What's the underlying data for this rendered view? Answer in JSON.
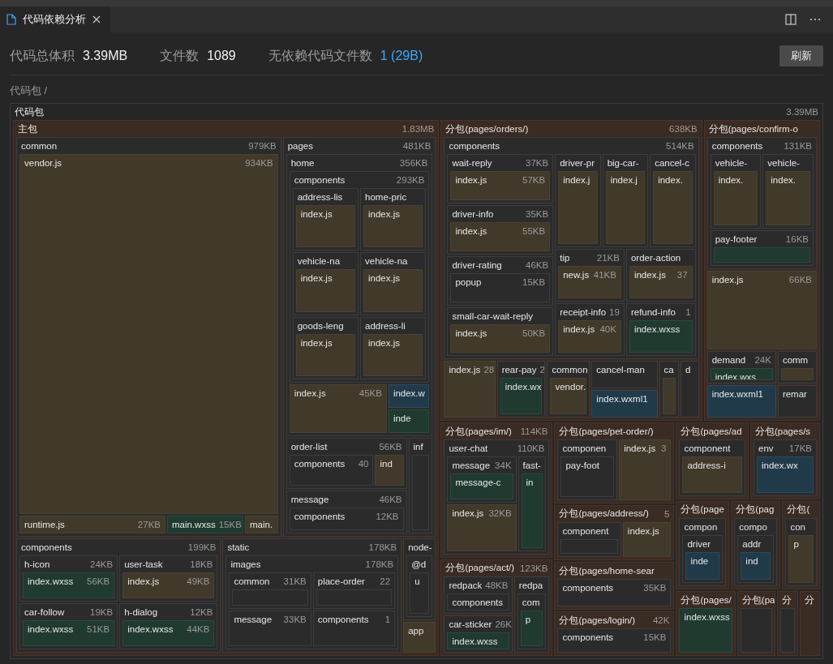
{
  "tab": {
    "title": "代码依赖分析",
    "selected": true
  },
  "stats": [
    {
      "label": "代码总体积",
      "value": "3.39MB",
      "kind": "plain"
    },
    {
      "label": "文件数",
      "value": "1089",
      "kind": "plain"
    },
    {
      "label": "无依赖代码文件数",
      "value": "1 (29B)",
      "kind": "link"
    }
  ],
  "refresh_button": "刷新",
  "breadcrumb": "代码包 /",
  "treemap": {
    "name": "代码包",
    "size": "3.39MB",
    "kind": "root",
    "children": [
      {
        "name": "主包",
        "size": "1.83MB",
        "kind": "package",
        "children": [
          {
            "name": "common",
            "size": "979KB",
            "kind": "folder",
            "children": [
              {
                "name": "vendor.js",
                "size": "934KB",
                "kind": "js"
              },
              {
                "name": "runtime.js",
                "size": "27KB",
                "kind": "js"
              },
              {
                "name": "main.wxss",
                "size": "15KB",
                "kind": "wxss"
              },
              {
                "name": "main.",
                "kind": "js"
              }
            ]
          },
          {
            "name": "pages",
            "size": "481KB",
            "kind": "folder",
            "children": [
              {
                "name": "home",
                "size": "356KB",
                "kind": "folder",
                "children": [
                  {
                    "name": "components",
                    "size": "293KB",
                    "kind": "folder",
                    "children": [
                      {
                        "name": "address-lis",
                        "kind": "folder",
                        "children": [
                          {
                            "name": "index.js",
                            "kind": "js"
                          }
                        ]
                      },
                      {
                        "name": "home-pric",
                        "kind": "folder",
                        "children": [
                          {
                            "name": "index.js",
                            "kind": "js"
                          }
                        ]
                      },
                      {
                        "name": "vehicle-na",
                        "kind": "folder",
                        "children": [
                          {
                            "name": "index.js",
                            "kind": "js"
                          }
                        ]
                      },
                      {
                        "name": "vehicle-na",
                        "kind": "folder",
                        "children": [
                          {
                            "name": "index.js",
                            "kind": "js"
                          }
                        ]
                      },
                      {
                        "name": "goods-leng",
                        "kind": "folder",
                        "children": [
                          {
                            "name": "index.js",
                            "kind": "js"
                          }
                        ]
                      },
                      {
                        "name": "address-li",
                        "kind": "folder",
                        "children": [
                          {
                            "name": "index.js",
                            "kind": "js"
                          }
                        ]
                      }
                    ]
                  },
                  {
                    "name": "index.js",
                    "size": "45KB",
                    "kind": "js"
                  },
                  {
                    "name": "index.w",
                    "kind": "wxml"
                  },
                  {
                    "name": "inde",
                    "kind": "wxss"
                  }
                ]
              },
              {
                "name": "order-list",
                "size": "56KB",
                "kind": "folder",
                "children": [
                  {
                    "name": "components",
                    "size": "40",
                    "kind": "folder"
                  },
                  {
                    "name": "ind",
                    "kind": "js"
                  }
                ]
              },
              {
                "name": "inf",
                "kind": "folder",
                "children": [
                  {
                    "kind": "folder"
                  }
                ]
              },
              {
                "name": "message",
                "size": "46KB",
                "kind": "folder",
                "children": [
                  {
                    "name": "components",
                    "size": "12KB",
                    "kind": "folder"
                  }
                ]
              }
            ]
          },
          {
            "name": "components",
            "size": "199KB",
            "kind": "folder",
            "children": [
              {
                "name": "h-icon",
                "size": "24KB",
                "kind": "folder",
                "children": [
                  {
                    "name": "index.wxss",
                    "size": "56KB",
                    "kind": "wxss"
                  }
                ]
              },
              {
                "name": "user-task",
                "size": "18KB",
                "kind": "folder",
                "children": [
                  {
                    "name": "index.js",
                    "size": "49KB",
                    "kind": "js"
                  }
                ]
              },
              {
                "name": "car-follow",
                "size": "19KB",
                "kind": "folder",
                "children": [
                  {
                    "name": "index.wxss",
                    "size": "51KB",
                    "kind": "wxss"
                  }
                ]
              },
              {
                "name": "h-dialog",
                "size": "12KB",
                "kind": "folder",
                "children": [
                  {
                    "name": "index.wxss",
                    "size": "44KB",
                    "kind": "wxss"
                  }
                ]
              }
            ]
          },
          {
            "name": "static",
            "size": "178KB",
            "kind": "folder",
            "children": [
              {
                "name": "images",
                "size": "178KB",
                "kind": "folder",
                "children": [
                  {
                    "name": "common",
                    "size": "31KB",
                    "kind": "folder",
                    "children": [
                      {
                        "kind": "folder"
                      }
                    ]
                  },
                  {
                    "name": "place-order",
                    "size": "22",
                    "kind": "folder",
                    "children": [
                      {
                        "kind": "folder"
                      }
                    ]
                  },
                  {
                    "name": "message",
                    "size": "33KB",
                    "kind": "folder"
                  },
                  {
                    "name": "components",
                    "size": "1",
                    "kind": "folder"
                  }
                ]
              }
            ]
          },
          {
            "name": "node-",
            "kind": "folder",
            "children": [
              {
                "name": "@d",
                "kind": "folder",
                "children": [
                  {
                    "name": "u",
                    "kind": "folder"
                  }
                ]
              }
            ]
          },
          {
            "name": "app",
            "kind": "js"
          }
        ]
      },
      {
        "name": "分包(pages/orders/)",
        "size": "638KB",
        "kind": "package",
        "children": [
          {
            "name": "components",
            "size": "514KB",
            "kind": "folder",
            "children": [
              {
                "name": "wait-reply",
                "size": "37KB",
                "kind": "folder",
                "children": [
                  {
                    "name": "index.js",
                    "size": "57KB",
                    "kind": "js"
                  }
                ]
              },
              {
                "name": "driver-pr",
                "kind": "folder",
                "children": [
                  {
                    "name": "index.j",
                    "kind": "js"
                  }
                ]
              },
              {
                "name": "big-car-",
                "kind": "folder",
                "children": [
                  {
                    "name": "index.j",
                    "kind": "js"
                  }
                ]
              },
              {
                "name": "cancel-c",
                "kind": "folder",
                "children": [
                  {
                    "name": "index.",
                    "kind": "js"
                  }
                ]
              },
              {
                "name": "driver-info",
                "size": "35KB",
                "kind": "folder",
                "children": [
                  {
                    "name": "index.js",
                    "size": "55KB",
                    "kind": "js"
                  }
                ]
              },
              {
                "name": "tip",
                "size": "21KB",
                "kind": "folder",
                "children": [
                  {
                    "name": "new.js",
                    "size": "41KB",
                    "kind": "js"
                  }
                ]
              },
              {
                "name": "order-action",
                "kind": "folder",
                "children": [
                  {
                    "name": "index.js",
                    "size": "37",
                    "kind": "js"
                  }
                ]
              },
              {
                "name": "driver-rating",
                "size": "46KB",
                "kind": "folder",
                "children": [
                  {
                    "name": "popup",
                    "size": "15KB",
                    "kind": "folder"
                  }
                ]
              },
              {
                "name": "small-car-wait-reply",
                "kind": "folder",
                "children": [
                  {
                    "name": "index.js",
                    "size": "50KB",
                    "kind": "js"
                  }
                ]
              },
              {
                "name": "receipt-info",
                "size": "19",
                "kind": "folder",
                "children": [
                  {
                    "name": "index.js",
                    "size": "40K",
                    "kind": "js"
                  }
                ]
              },
              {
                "name": "refund-info",
                "size": "1",
                "kind": "folder",
                "children": [
                  {
                    "name": "index.wxss",
                    "kind": "wxss"
                  }
                ]
              }
            ]
          },
          {
            "name": "index.js",
            "size": "28",
            "kind": "js"
          },
          {
            "name": "rear-pay",
            "size": "2",
            "kind": "folder",
            "children": [
              {
                "name": "index.wx",
                "kind": "wxss"
              }
            ]
          },
          {
            "name": "common",
            "kind": "folder",
            "children": [
              {
                "name": "vendor.",
                "kind": "js"
              }
            ]
          },
          {
            "name": "cancel-man",
            "kind": "folder"
          },
          {
            "name": "index.wxml1",
            "kind": "wxml"
          },
          {
            "name": "ca",
            "kind": "folder",
            "children": [
              {
                "kind": "js"
              }
            ]
          },
          {
            "name": "d",
            "kind": "folder"
          }
        ]
      },
      {
        "name": "分包(pages/confirm-o",
        "kind": "package",
        "children": [
          {
            "name": "components",
            "size": "131KB",
            "kind": "folder",
            "children": [
              {
                "name": "vehicle-",
                "kind": "folder",
                "children": [
                  {
                    "name": "index.",
                    "kind": "js"
                  }
                ]
              },
              {
                "name": "vehicle-",
                "kind": "folder",
                "children": [
                  {
                    "name": "index.",
                    "kind": "js"
                  }
                ]
              },
              {
                "name": "pay-footer",
                "size": "16KB",
                "kind": "folder",
                "children": [
                  {
                    "kind": "wxss"
                  }
                ]
              }
            ]
          },
          {
            "name": "index.js",
            "size": "66KB",
            "kind": "js"
          },
          {
            "name": "demand",
            "size": "24K",
            "kind": "folder",
            "children": [
              {
                "name": "index.wxs",
                "kind": "wxss"
              }
            ]
          },
          {
            "name": "comm",
            "kind": "folder",
            "children": [
              {
                "kind": "js"
              }
            ]
          },
          {
            "name": "index.wxml1",
            "kind": "wxml"
          },
          {
            "name": "remar",
            "kind": "folder"
          }
        ]
      },
      {
        "name": "分包(pages/im/)",
        "size": "114KB",
        "kind": "package",
        "children": [
          {
            "name": "user-chat",
            "size": "110KB",
            "kind": "folder",
            "children": [
              {
                "name": "message",
                "size": "34K",
                "kind": "folder",
                "children": [
                  {
                    "name": "message-c",
                    "kind": "wxss"
                  }
                ]
              },
              {
                "name": "fast-",
                "kind": "folder",
                "children": [
                  {
                    "name": "in",
                    "kind": "wxss"
                  }
                ]
              },
              {
                "name": "index.js",
                "size": "32KB",
                "kind": "js"
              }
            ]
          }
        ]
      },
      {
        "name": "分包(pages/act/)",
        "size": "123KB",
        "kind": "package",
        "children": [
          {
            "name": "redpack",
            "size": "48KB",
            "kind": "folder",
            "children": [
              {
                "name": "components",
                "kind": "folder"
              }
            ]
          },
          {
            "name": "car-sticker",
            "size": "26K",
            "kind": "folder",
            "children": [
              {
                "name": "index.wxss",
                "kind": "wxss"
              }
            ]
          },
          {
            "name": "redpa",
            "kind": "folder",
            "children": [
              {
                "name": "com",
                "kind": "folder",
                "children": [
                  {
                    "name": "p",
                    "kind": "wxss"
                  }
                ]
              }
            ]
          }
        ]
      },
      {
        "name": "分包(pages/pet-order/)",
        "kind": "package",
        "children": [
          {
            "name": "componen",
            "kind": "folder",
            "children": [
              {
                "name": "pay-foot",
                "kind": "folder"
              }
            ]
          },
          {
            "name": "index.js",
            "size": "3",
            "kind": "js"
          }
        ]
      },
      {
        "name": "分包(pages/address/)",
        "size": "5",
        "kind": "package",
        "children": [
          {
            "name": "component",
            "kind": "folder",
            "children": [
              {
                "kind": "folder"
              }
            ]
          },
          {
            "name": "index.js",
            "kind": "js"
          }
        ]
      },
      {
        "name": "分包(pages/home-sear",
        "kind": "package",
        "children": [
          {
            "name": "components",
            "size": "35KB",
            "kind": "folder"
          }
        ]
      },
      {
        "name": "分包(pages/login/)",
        "size": "42K",
        "kind": "package",
        "children": [
          {
            "name": "components",
            "size": "15KB",
            "kind": "folder"
          }
        ]
      },
      {
        "name": "分包(pages/ad",
        "kind": "package",
        "children": [
          {
            "name": "component",
            "kind": "folder",
            "children": [
              {
                "name": "address-i",
                "kind": "js"
              }
            ]
          }
        ]
      },
      {
        "name": "分包(pages/s",
        "kind": "package",
        "children": [
          {
            "name": "env",
            "size": "17KB",
            "kind": "folder",
            "children": [
              {
                "name": "index.wx",
                "kind": "wxml"
              }
            ]
          }
        ]
      },
      {
        "name": "分包(page",
        "kind": "package",
        "children": [
          {
            "name": "compon",
            "kind": "folder",
            "children": [
              {
                "name": "driver",
                "kind": "folder",
                "children": [
                  {
                    "name": "inde",
                    "kind": "wxml"
                  }
                ]
              }
            ]
          }
        ]
      },
      {
        "name": "分包(pag",
        "kind": "package",
        "children": [
          {
            "name": "compo",
            "kind": "folder",
            "children": [
              {
                "name": "addr",
                "kind": "folder",
                "children": [
                  {
                    "name": "ind",
                    "kind": "wxml"
                  }
                ]
              }
            ]
          }
        ]
      },
      {
        "name": "分包(",
        "kind": "package",
        "children": [
          {
            "name": "con",
            "kind": "folder",
            "children": [
              {
                "name": "p",
                "kind": "js"
              }
            ]
          }
        ]
      },
      {
        "name": "分包(pages/",
        "kind": "package",
        "children": [
          {
            "name": "index.wxss",
            "kind": "wxss"
          }
        ]
      },
      {
        "name": "分包(pa",
        "kind": "package",
        "children": [
          {
            "kind": "folder"
          }
        ]
      },
      {
        "name": "分",
        "kind": "package",
        "children": [
          {
            "kind": "folder"
          }
        ]
      },
      {
        "name": "分",
        "kind": "package"
      }
    ]
  }
}
